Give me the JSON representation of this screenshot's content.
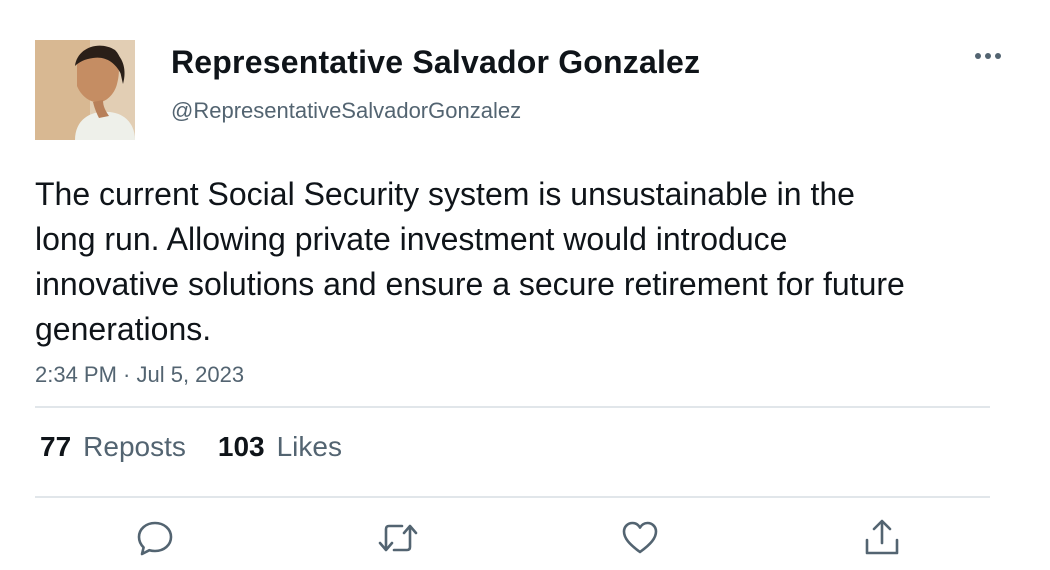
{
  "author": {
    "name": "Representative Salvador Gonzalez",
    "handle": "@RepresentativeSalvadorGonzalez",
    "avatar_icon": "profile-photo"
  },
  "tweet": {
    "text": "The current Social Security system is unsustainable in the long run. Allowing private investment would introduce innovative solutions and ensure a secure retirement for future generations.",
    "timestamp": "2:34 PM · Jul 5, 2023"
  },
  "stats": {
    "reposts_count": "77",
    "reposts_label": "Reposts",
    "likes_count": "103",
    "likes_label": "Likes"
  },
  "actions": [
    "reply-icon",
    "repost-icon",
    "like-icon",
    "share-icon"
  ],
  "colors": {
    "text_primary": "#0f1419",
    "text_secondary": "#536471",
    "icon": "#536471",
    "divider": "#e1e6ea"
  }
}
